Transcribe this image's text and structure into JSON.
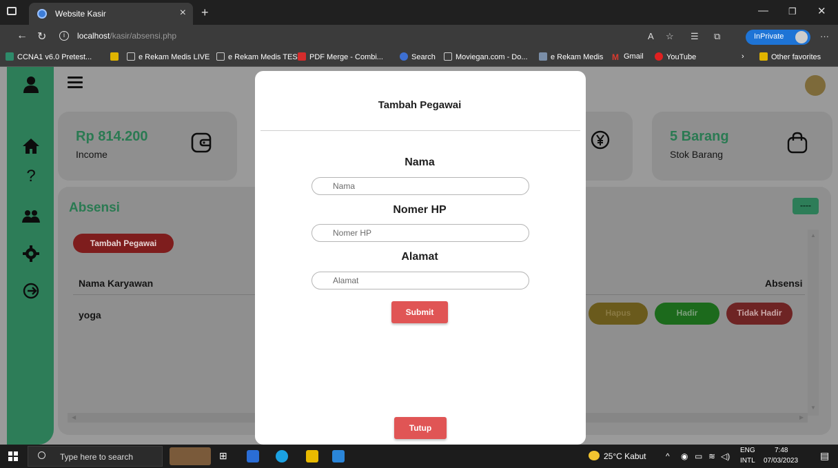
{
  "browser": {
    "tab_title": "Website Kasir",
    "url_host": "localhost",
    "url_path": "/kasir/absensi.php",
    "inprivate_label": "InPrivate",
    "bookmarks": [
      "CCNA1 v6.0 Pretest...",
      "e Rekam Medis LIVE",
      "e Rekam Medis TEST",
      "PDF Merge - Combi...",
      "Search",
      "Moviegan.com - Do...",
      "e Rekam Medis",
      "Gmail",
      "YouTube"
    ],
    "other_favorites": "Other favorites"
  },
  "cards": [
    {
      "value": "Rp 814.200",
      "label": "Income",
      "icon": "wallet-icon"
    },
    {
      "value": "5 Barang",
      "label": "Stok Barang",
      "icon": "shopping-bag-icon"
    }
  ],
  "panel": {
    "title": "Absensi",
    "add_button": "Tambah Pegawai",
    "dash_button": "----",
    "columns": [
      "Nama Karyawan",
      "Absensi"
    ],
    "rows": [
      {
        "name": "yoga",
        "actions": [
          "Hapus",
          "Hadir",
          "Tidak Hadir"
        ]
      }
    ]
  },
  "modal": {
    "title": "Tambah Pegawai",
    "fields": [
      {
        "label": "Nama",
        "placeholder": "Nama"
      },
      {
        "label": "Nomer HP",
        "placeholder": "Nomer HP"
      },
      {
        "label": "Alamat",
        "placeholder": "Alamat"
      }
    ],
    "submit_label": "Submit",
    "close_label": "Tutup"
  },
  "taskbar": {
    "search_placeholder": "Type here to search",
    "weather": "25°C Kabut",
    "lang_top": "ENG",
    "lang_bottom": "INTL",
    "time": "7:48",
    "date": "07/03/2023"
  },
  "colors": {
    "accent_green": "#48c48c",
    "danger_red": "#d63a3a",
    "warning_yellow": "#e6b800",
    "success_green": "#22c222",
    "overlay": "rgba(0,0,0,0.4)"
  }
}
